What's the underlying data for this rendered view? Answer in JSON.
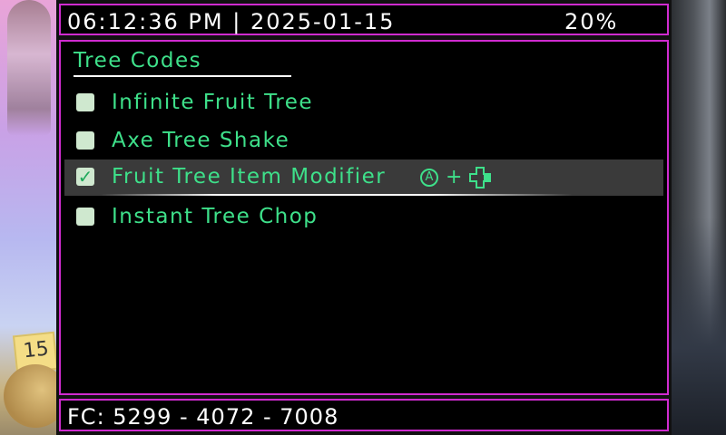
{
  "status_bar": {
    "clock": "06:12:36 PM | 2025-01-15",
    "battery": "20%"
  },
  "menu": {
    "title": "Tree Codes",
    "items": [
      {
        "label": "Infinite Fruit Tree",
        "checked": false
      },
      {
        "label": "Axe Tree Shake",
        "checked": false
      },
      {
        "label": "Fruit Tree Item Modifier",
        "checked": true,
        "hotkey": {
          "button": "A",
          "joiner": "+",
          "dpad_icon": "dpad-right-icon"
        }
      },
      {
        "label": "Instant Tree Chop",
        "checked": false
      }
    ],
    "selected_index": 2,
    "accent_color": "#3ee08a",
    "border_color": "#d02bd0"
  },
  "background": {
    "note_number": "15"
  },
  "footer": {
    "friend_code": "FC: 5299 - 4072 - 7008"
  }
}
